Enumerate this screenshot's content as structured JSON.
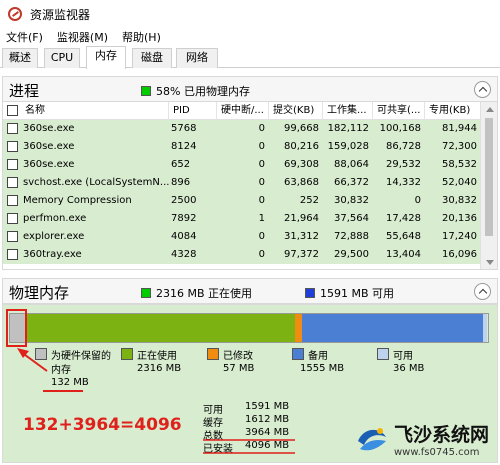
{
  "window": {
    "title": "资源监视器"
  },
  "menu": [
    "文件(F)",
    "监视器(M)",
    "帮助(H)"
  ],
  "tabs": [
    {
      "label": "概述",
      "active": false
    },
    {
      "label": "CPU",
      "active": false
    },
    {
      "label": "内存",
      "active": true
    },
    {
      "label": "磁盘",
      "active": false
    },
    {
      "label": "网络",
      "active": false
    }
  ],
  "process_section": {
    "title": "进程",
    "summary": "58% 已用物理内存",
    "summary_color": "#00cc00"
  },
  "table": {
    "headers": [
      "名称",
      "PID",
      "硬中断/...",
      "提交(KB)",
      "工作集...",
      "可共享(...",
      "专用(KB)"
    ],
    "rows": [
      [
        "360se.exe",
        "5768",
        "0",
        "99,668",
        "182,112",
        "100,168",
        "81,944"
      ],
      [
        "360se.exe",
        "8124",
        "0",
        "80,216",
        "159,028",
        "86,728",
        "72,300"
      ],
      [
        "360se.exe",
        "652",
        "0",
        "69,308",
        "88,064",
        "29,532",
        "58,532"
      ],
      [
        "svchost.exe (LocalSystemN...",
        "896",
        "0",
        "63,868",
        "66,372",
        "14,332",
        "52,040"
      ],
      [
        "Memory Compression",
        "2500",
        "0",
        "252",
        "30,832",
        "0",
        "30,832"
      ],
      [
        "perfmon.exe",
        "7892",
        "1",
        "21,964",
        "37,564",
        "17,428",
        "20,136"
      ],
      [
        "explorer.exe",
        "4084",
        "0",
        "31,312",
        "72,888",
        "55,648",
        "17,240"
      ],
      [
        "360tray.exe",
        "4328",
        "0",
        "97,372",
        "29,500",
        "13,404",
        "16,096"
      ]
    ]
  },
  "memory_section": {
    "title": "物理内存",
    "in_use_summary": "2316 MB 正在使用",
    "available_summary": "1591 MB 可用",
    "in_use_color": "#00cc00",
    "available_color": "#1f3fd8"
  },
  "memory_bar": {
    "hardware_reserved_mb": 132,
    "in_use_mb": 2316,
    "modified_mb": 57,
    "standby_mb": 1555,
    "free_mb": 36
  },
  "legend": [
    {
      "label": "为硬件保留的",
      "label2": "内存",
      "value": "132 MB",
      "color": "#c0c0c0"
    },
    {
      "label": "正在使用",
      "value": "2316 MB",
      "color": "#7cb313"
    },
    {
      "label": "已修改",
      "value": "57 MB",
      "color": "#f08c10"
    },
    {
      "label": "备用",
      "value": "1555 MB",
      "color": "#4a7fd4"
    },
    {
      "label": "可用",
      "value": "36 MB",
      "color": "#bcd2ee"
    }
  ],
  "stats": [
    {
      "key": "可用",
      "value": "1591 MB"
    },
    {
      "key": "缓存",
      "value": "1612 MB"
    },
    {
      "key": "总数",
      "value": "3964 MB"
    },
    {
      "key": "已安装",
      "value": "4096 MB"
    }
  ],
  "annotation": {
    "equation": "132+3964=4096",
    "color": "#e0201b"
  },
  "watermark": {
    "name": "飞沙系统网",
    "url": "www.fs0745.com"
  }
}
